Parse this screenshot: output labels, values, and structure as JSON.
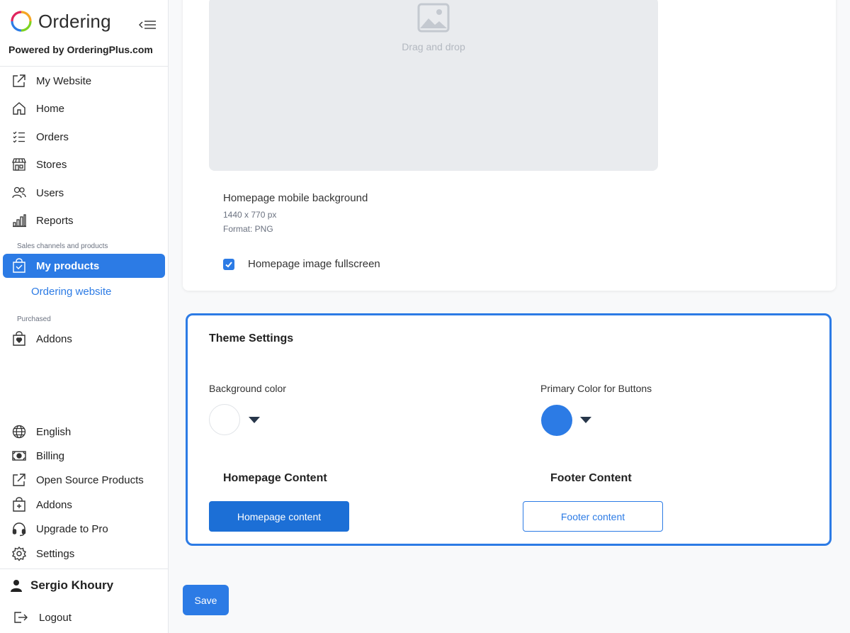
{
  "brand": {
    "name": "Ordering",
    "powered_by": "Powered by OrderingPlus.com"
  },
  "sidebar": {
    "nav": [
      {
        "label": "My Website",
        "icon": "external-link-icon"
      },
      {
        "label": "Home",
        "icon": "home-icon"
      },
      {
        "label": "Orders",
        "icon": "list-check-icon"
      },
      {
        "label": "Stores",
        "icon": "shop-icon"
      },
      {
        "label": "Users",
        "icon": "users-icon"
      },
      {
        "label": "Reports",
        "icon": "bar-chart-icon"
      }
    ],
    "section_sales": "Sales channels and products",
    "my_products": "My products",
    "ordering_website": "Ordering website",
    "section_purchased": "Purchased",
    "addons": "Addons",
    "bottom": [
      {
        "label": "English",
        "icon": "globe-icon"
      },
      {
        "label": "Billing",
        "icon": "cash-icon"
      },
      {
        "label": "Open Source Products",
        "icon": "external-link-icon"
      },
      {
        "label": "Addons",
        "icon": "bag-plus-icon"
      },
      {
        "label": "Upgrade to Pro",
        "icon": "headset-icon"
      },
      {
        "label": "Settings",
        "icon": "gear-icon"
      }
    ],
    "user_name": "Sergio Khoury",
    "logout": "Logout"
  },
  "background_upload": {
    "dropzone_text": "Drag and drop",
    "title": "Homepage mobile background",
    "size": "1440 x 770 px",
    "format": "Format: PNG",
    "fullscreen_label": "Homepage image fullscreen",
    "fullscreen_checked": true
  },
  "theme": {
    "title": "Theme Settings",
    "background_color_label": "Background color",
    "background_color": "#ffffff",
    "primary_color_label": "Primary Color for Buttons",
    "primary_color": "#2c7be5",
    "homepage_content_title": "Homepage Content",
    "homepage_content_button": "Homepage content",
    "footer_content_title": "Footer Content",
    "footer_content_button": "Footer content"
  },
  "save_label": "Save",
  "colors": {
    "accent": "#2c7be5",
    "accent_dark": "#1c6fd6"
  }
}
